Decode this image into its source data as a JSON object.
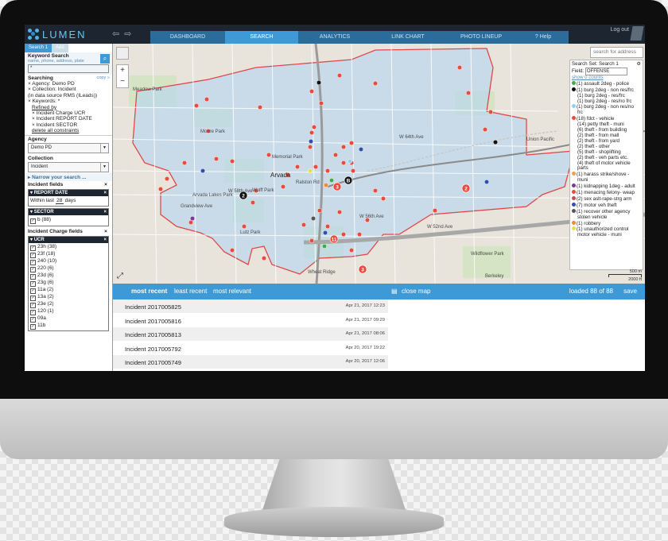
{
  "app": {
    "brand": "LUMEN",
    "logout": "Log out"
  },
  "nav": {
    "tabs": [
      "DASHBOARD",
      "SEARCH",
      "ANALYTICS",
      "LINK CHART",
      "PHOTO LINEUP",
      "? Help"
    ],
    "active": "SEARCH"
  },
  "left_panel": {
    "tabs": [
      "Search 1",
      "Add"
    ],
    "keyword_title": "Keyword Search",
    "keyword_hint": "name, phone, address, plate",
    "keyword_value": "*",
    "searching_title": "Searching",
    "copy_link": "copy »",
    "constraints": [
      "× Agency: Demo PD",
      "× Collection: Incident",
      "(in data source RMS (ILeads))",
      "× Keywords: *"
    ],
    "refined_by": "Refined by",
    "refinements": [
      "× Incident Charge UCR",
      "× Incident REPORT DATE",
      "× Incident SECTOR"
    ],
    "delete_all": "delete all constraints",
    "agency_title": "Agency",
    "agency_value": "Demo PD",
    "collection_title": "Collection",
    "collection_value": "Incident",
    "narrow_link": "Narrow your search ...",
    "incident_fields_title": "Incident fields",
    "report_date": {
      "header": "REPORT DATE",
      "prefix": "Within last",
      "value": "28",
      "suffix": "days"
    },
    "sector": {
      "header": "SECTOR",
      "item": "b (88)"
    },
    "charge_fields_title": "Incident Charge fields",
    "ucr": {
      "header": "UCR",
      "items": [
        "23h (38)",
        "23f (18)",
        "240 (10)",
        "220 (6)",
        "23d (6)",
        "23g (6)",
        "11a (2)",
        "13a (2)",
        "23e (2)",
        "120 (1)",
        "09a",
        "11b"
      ]
    }
  },
  "map": {
    "search_placeholder": "search for address",
    "legend": {
      "title": "Search Set: Search 1",
      "field_label": "Field:",
      "field_value": "OFFENSE",
      "show_counts": "show 0 counts",
      "entries": [
        {
          "text": "(1) assault 2deg - police",
          "color": "#3fae49",
          "indent": false
        },
        {
          "text": "(1) burg 2deg - non res/frc",
          "color": "#111111",
          "indent": false
        },
        {
          "text": "(1) burg 2deg - res/frc",
          "color": "",
          "indent": true
        },
        {
          "text": "(1) burg 2deg - res/no frc",
          "color": "",
          "indent": true
        },
        {
          "text": "(1) burg 2deg - non res/no",
          "color": "#8fd0f0",
          "indent": false
        },
        {
          "text": "frc",
          "color": "",
          "indent": true
        },
        {
          "text": "(18) fdct - vehicle",
          "color": "#e84a3c",
          "indent": false
        },
        {
          "text": "(14) petty theft - muni",
          "color": "",
          "indent": true
        },
        {
          "text": "(6) theft - from building",
          "color": "",
          "indent": true
        },
        {
          "text": "(2) theft - from mall",
          "color": "",
          "indent": true
        },
        {
          "text": "(2) theft - from yard",
          "color": "",
          "indent": true
        },
        {
          "text": "(2) theft - other",
          "color": "",
          "indent": true
        },
        {
          "text": "(5) theft - shoplifting",
          "color": "",
          "indent": true
        },
        {
          "text": "(2) theft - veh parts etc.",
          "color": "",
          "indent": true
        },
        {
          "text": "(4) theft of motor vehicle",
          "color": "",
          "indent": true
        },
        {
          "text": "parts",
          "color": "",
          "indent": true
        },
        {
          "text": "(1) harass strike/shove -",
          "color": "#f0a050",
          "indent": false
        },
        {
          "text": "muni",
          "color": "",
          "indent": true
        },
        {
          "text": "(1) kidnapping 1deg - adult",
          "color": "#7a3a9a",
          "indent": false
        },
        {
          "text": "(1) menacing felony- weap",
          "color": "#e84a3c",
          "indent": false
        },
        {
          "text": "(2) sex aslt-rape-strg arm",
          "color": "#c05050",
          "indent": false
        },
        {
          "text": "(7) motor veh theft",
          "color": "#2e4fb5",
          "indent": false
        },
        {
          "text": "(1) recover other agency",
          "color": "#555555",
          "indent": false
        },
        {
          "text": "stolen vehicle",
          "color": "",
          "indent": true
        },
        {
          "text": "(1) robbery",
          "color": "#f08a30",
          "indent": false
        },
        {
          "text": "(1) unauthorized control",
          "color": "#e8e04a",
          "indent": false
        },
        {
          "text": "motor vehicle - muni",
          "color": "",
          "indent": true
        }
      ]
    },
    "scale": {
      "top": "500 m",
      "bottom": "2000 ft"
    },
    "labels": [
      "Arvada",
      "Ralston Rd",
      "W 58th Ave",
      "W 56th Ave",
      "W 52nd Ave",
      "W 64th Ave",
      "Grandview Ave",
      "Memorial Park",
      "Arvada Lakes Park",
      "Wolff Park",
      "Lutz Park",
      "Union Pacific",
      "Moore Park",
      "Meadow Park",
      "Wildflower Park",
      "Berkeley",
      "Wheat Ridge"
    ],
    "markers": {
      "A": "A",
      "B": "B",
      "2": "2",
      "3": "3",
      "11": "11",
      "1": "1"
    }
  },
  "results_bar": {
    "most_recent": "most recent",
    "least_recent": "least recent",
    "most_relevant": "most relevant",
    "close_map": "close map",
    "loaded": "loaded 88 of 88",
    "save": "save"
  },
  "results": [
    {
      "name": "Incident 2017005825",
      "date": "Apr 21, 2017 12:23"
    },
    {
      "name": "Incident 2017005816",
      "date": "Apr 21, 2017 09:29"
    },
    {
      "name": "Incident 2017005813",
      "date": "Apr 21, 2017 08:06"
    },
    {
      "name": "Incident 2017005792",
      "date": "Apr 20, 2017 19:22"
    },
    {
      "name": "Incident 2017005749",
      "date": "Apr 20, 2017 12:06"
    }
  ]
}
